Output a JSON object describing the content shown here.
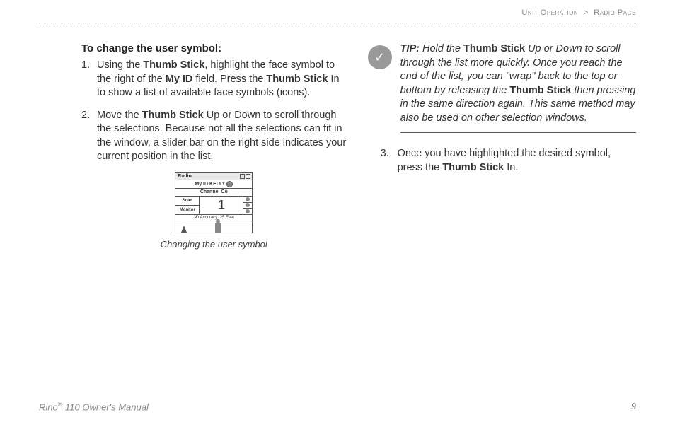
{
  "breadcrumb": {
    "section": "Unit Operation",
    "sep": ">",
    "page": "Radio Page"
  },
  "heading": "To change the user symbol:",
  "step1": {
    "t1": "Using the ",
    "b1": "Thumb Stick",
    "t2": ", highlight the face symbol to the right of the ",
    "b2": "My ID",
    "t3": " field. Press the ",
    "b3": "Thumb Stick",
    "t4": " In to show a list of available face symbols (icons)."
  },
  "step2": {
    "t1": "Move the ",
    "b1": "Thumb Stick",
    "t2": " Up or Down to scroll through the selections. Because not all the selections can fit in the window, a slider bar on the right side indicates your current position in the list."
  },
  "device": {
    "title": "Radio",
    "id_label": "My ID",
    "id_value": "KELLY",
    "ch_row": "Channel   Co",
    "btn1": "Scan",
    "btn2": "Monitor",
    "channel": "1",
    "acc": "3D Accuracy: 25 Feet"
  },
  "caption": "Changing the user symbol",
  "tip": {
    "label": "TIP:",
    "t1": " Hold the ",
    "b1": "Thumb Stick",
    "t2": " Up or Down to scroll through the list more quickly. Once you reach the end of the list, you can \"wrap\" back to the top or bottom by releasing the ",
    "b2": "Thumb Stick",
    "t3": " then pressing in the same direction again. This same method may also be used on other selection windows."
  },
  "step3": {
    "num": "3.",
    "t1": "Once you have highlighted the desired symbol, press the ",
    "b1": "Thumb Stick",
    "t2": " In."
  },
  "footer": {
    "product": "Rino",
    "reg": "®",
    "model": " 110 Owner's Manual",
    "pagenum": "9"
  }
}
